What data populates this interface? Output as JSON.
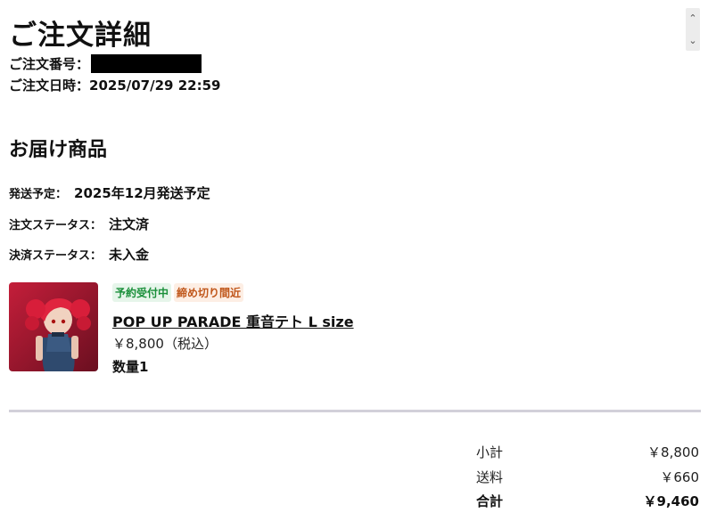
{
  "header": {
    "title": "ご注文詳細",
    "order_number_label": "ご注文番号：",
    "order_date_label": "ご注文日時：",
    "order_date_value": "2025/07/29 22:59"
  },
  "delivery": {
    "section_title": "お届け商品",
    "shipping_label": "発送予定：",
    "shipping_value": "2025年12月発送予定",
    "order_status_label": "注文ステータス：",
    "order_status_value": "注文済",
    "payment_status_label": "決済ステータス：",
    "payment_status_value": "未入金"
  },
  "product": {
    "badges": [
      "予約受付中",
      "締め切り間近"
    ],
    "name": "POP UP PARADE 重音テト L size",
    "price": "￥8,800（税込）",
    "quantity": "数量1"
  },
  "summary": {
    "subtotal_label": "小計",
    "subtotal_value": "￥8,800",
    "shipping_label": "送料",
    "shipping_value": "￥660",
    "total_label": "合計",
    "total_value": "￥9,460"
  },
  "colors": {
    "badge_green": "#1a8f3a",
    "badge_orange": "#c0561a",
    "divider": "#d2d0d9"
  },
  "icons": {
    "scroll_up": "chevron-up-icon",
    "scroll_down": "chevron-down-icon"
  }
}
